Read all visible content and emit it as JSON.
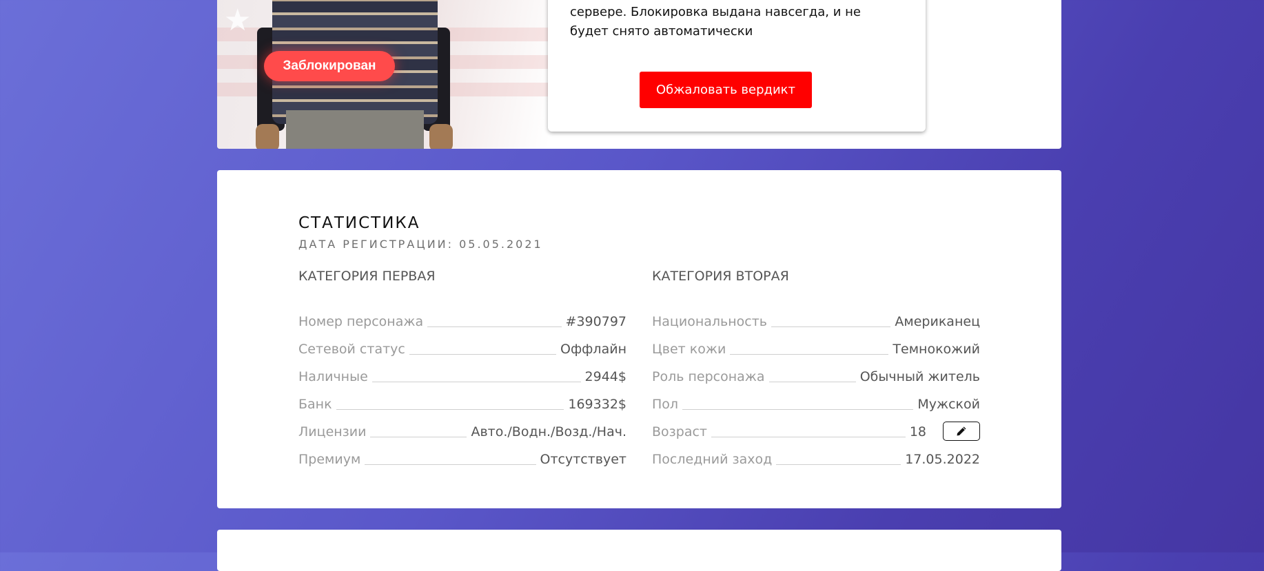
{
  "player": {
    "status_badge": "Заблокирован"
  },
  "ban": {
    "message": "сервере. Блокировка выдана навсегда, и не будет снято автоматически",
    "appeal_button": "Обжаловать вердикт"
  },
  "stats": {
    "title": "СТАТИСТИКА",
    "registration": "ДАТА РЕГИСТРАЦИИ: 05.05.2021",
    "category_one": {
      "heading": "КАТЕГОРИЯ ПЕРВАЯ",
      "rows": [
        {
          "label": "Номер персонажа",
          "value": "#390797"
        },
        {
          "label": "Сетевой статус",
          "value": "Оффлайн"
        },
        {
          "label": "Наличные",
          "value": "2944$"
        },
        {
          "label": "Банк",
          "value": "169332$"
        },
        {
          "label": "Лицензии",
          "value": "Авто./Водн./Возд./Нач."
        },
        {
          "label": "Премиум",
          "value": "Отсутствует"
        }
      ]
    },
    "category_two": {
      "heading": "КАТЕГОРИЯ ВТОРАЯ",
      "rows": [
        {
          "label": "Национальность",
          "value": "Американец"
        },
        {
          "label": "Цвет кожи",
          "value": "Темнокожий"
        },
        {
          "label": "Роль персонажа",
          "value": "Обычный житель"
        },
        {
          "label": "Пол",
          "value": "Мужской"
        },
        {
          "label": "Возраст",
          "value": "18"
        },
        {
          "label": "Последний заход",
          "value": "17.05.2022"
        }
      ]
    }
  },
  "icons": {
    "edit": "pencil-icon"
  },
  "colors": {
    "accent_red": "#ff0000",
    "badge_red": "#ff4b4b",
    "bg_gradient_start": "#6b6fd8",
    "bg_gradient_end": "#4536a3"
  }
}
